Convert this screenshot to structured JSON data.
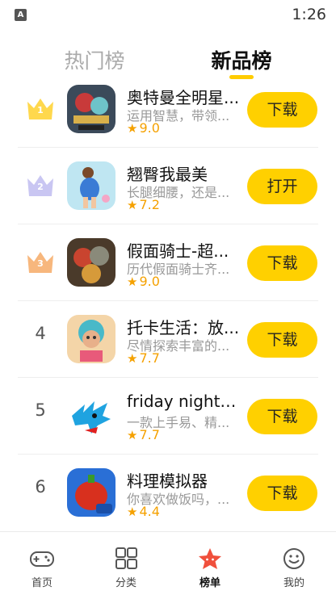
{
  "status_bar": {
    "time": "1:26",
    "indicator": "A"
  },
  "tabs": [
    {
      "label": "热门榜",
      "active": false
    },
    {
      "label": "新品榜",
      "active": true
    }
  ],
  "rankings": [
    {
      "rank": "1",
      "name": "奥特曼全明星...",
      "desc": "运用智慧，带领...",
      "rating": "9.0",
      "action": "下载",
      "crown_color": "#ffd84d"
    },
    {
      "rank": "2",
      "name": "翘臀我最美",
      "desc": "长腿细腰，还是...",
      "rating": "7.2",
      "action": "打开",
      "crown_color": "#c9c6f2"
    },
    {
      "rank": "3",
      "name": "假面骑士-超...",
      "desc": "历代假面骑士齐...",
      "rating": "9.0",
      "action": "下载",
      "crown_color": "#f7b77d"
    },
    {
      "rank": "4",
      "name": "托卡生活：放...",
      "desc": "尽情探索丰富的...",
      "rating": "7.7",
      "action": "下载"
    },
    {
      "rank": "5",
      "name": "friday night f...",
      "desc": "一款上手易、精...",
      "rating": "7.7",
      "action": "下载"
    },
    {
      "rank": "6",
      "name": "料理模拟器",
      "desc": "你喜欢做饭吗，...",
      "rating": "4.4",
      "action": "下载"
    }
  ],
  "bottom_nav": [
    {
      "label": "首页",
      "icon": "gamepad-icon",
      "active": false
    },
    {
      "label": "分类",
      "icon": "grid-icon",
      "active": false
    },
    {
      "label": "榜单",
      "icon": "star-badge-icon",
      "active": true
    },
    {
      "label": "我的",
      "icon": "smiley-icon",
      "active": false
    }
  ],
  "colors": {
    "accent": "#ffd000",
    "rating": "#f5a100",
    "active_nav": "#f0503c"
  }
}
